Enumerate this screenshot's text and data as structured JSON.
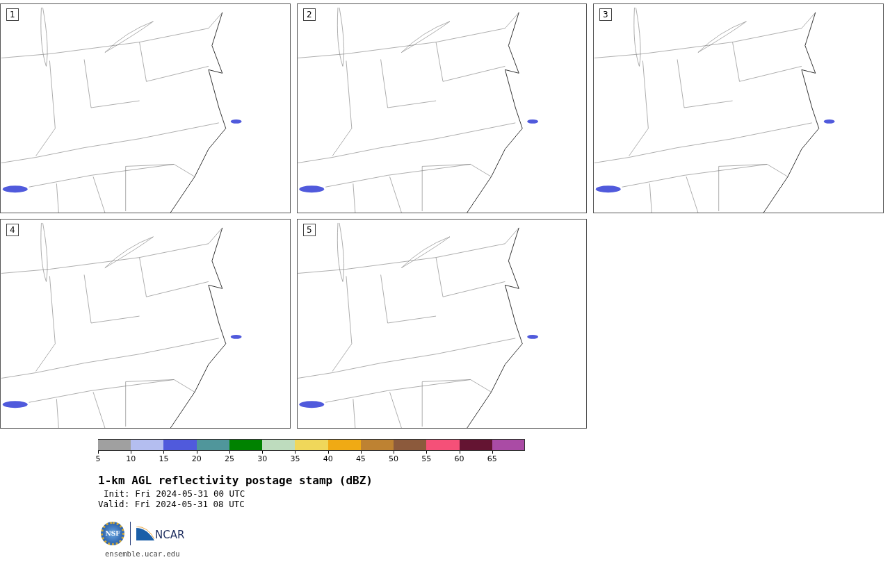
{
  "panels": [
    {
      "number": "1"
    },
    {
      "number": "2"
    },
    {
      "number": "3"
    },
    {
      "number": "4"
    },
    {
      "number": "5"
    }
  ],
  "colorbar": {
    "bins": [
      {
        "color": "#a0a0a0"
      },
      {
        "color": "#b4bef0"
      },
      {
        "color": "#505adc"
      },
      {
        "color": "#50969b"
      },
      {
        "color": "#008200"
      },
      {
        "color": "#bedcbe"
      },
      {
        "color": "#f0d75a"
      },
      {
        "color": "#f0aa14"
      },
      {
        "color": "#be8232"
      },
      {
        "color": "#8c5a3c"
      },
      {
        "color": "#f55078"
      },
      {
        "color": "#641432"
      },
      {
        "color": "#aa4ba5"
      }
    ],
    "ticks": [
      "5",
      "10",
      "15",
      "20",
      "25",
      "30",
      "35",
      "40",
      "45",
      "50",
      "55",
      "60",
      "65"
    ]
  },
  "title": "1-km AGL reflectivity postage stamp (dBZ)",
  "init": "Init: Fri 2024-05-31 00 UTC",
  "valid": "Valid: Fri 2024-05-31 08 UTC",
  "logo": {
    "nsf": "NSF",
    "ncar": "NCAR"
  },
  "url": "ensemble.ucar.edu"
}
